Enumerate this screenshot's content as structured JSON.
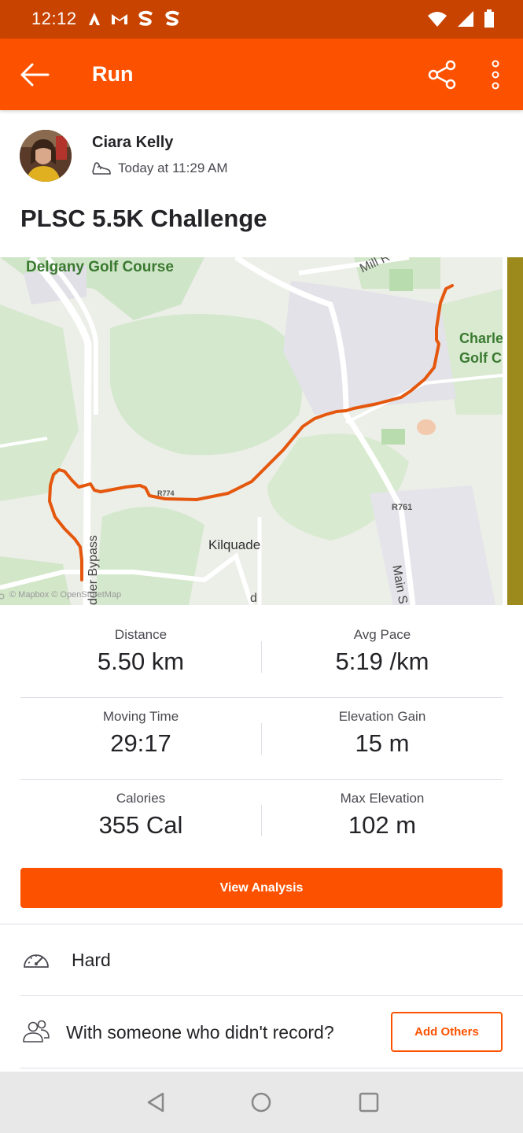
{
  "status_bar": {
    "time": "12:12",
    "icons": [
      "strava-notification-icon",
      "gmail-icon",
      "s-app-icon",
      "s-app-icon",
      "wifi-icon",
      "signal-icon",
      "battery-icon"
    ]
  },
  "app_bar": {
    "title": "Run",
    "back_icon": "arrow-left-icon",
    "share_icon": "share-icon",
    "more_icon": "more-vertical-icon"
  },
  "athlete": {
    "name": "Ciara Kelly",
    "time": "Today at 11:29 AM",
    "activity_icon": "shoe-icon"
  },
  "activity": {
    "title": "PLSC 5.5K Challenge"
  },
  "map": {
    "labels": {
      "golf_course": "Delgany Golf Course",
      "mill_road": "Mill R",
      "charle": "Charle",
      "golf_c": "Golf C",
      "r761": "R761",
      "r774": "R774",
      "kilquade": "Kilquade",
      "bypass": "Bypass",
      "kilcoole_bypass": "dder Bypass",
      "main": "Main S",
      "road_d": "d",
      "attribution": "© Mapbox © OpenStreetMap"
    },
    "route_color": "#e4570d"
  },
  "stats": [
    {
      "left": {
        "label": "Distance",
        "value": "5.50 km"
      },
      "right": {
        "label": "Avg Pace",
        "value": "5:19 /km"
      }
    },
    {
      "left": {
        "label": "Moving Time",
        "value": "29:17"
      },
      "right": {
        "label": "Elevation Gain",
        "value": "15 m"
      }
    },
    {
      "left": {
        "label": "Calories",
        "value": "355 Cal"
      },
      "right": {
        "label": "Max Elevation",
        "value": "102 m"
      }
    }
  ],
  "view_analysis_label": "View Analysis",
  "perceived_exertion": {
    "icon": "gauge-icon",
    "label": "Hard"
  },
  "add_others": {
    "icon": "people-icon",
    "prompt": "With someone who didn't record?",
    "button_label": "Add Others"
  },
  "nav_bar": {
    "back_icon": "nav-back-icon",
    "home_icon": "nav-home-icon",
    "recents_icon": "nav-recents-icon"
  },
  "colors": {
    "brand": "#fc5200",
    "status_bar": "#c84300",
    "text": "#242428",
    "secondary_text": "#494950"
  }
}
